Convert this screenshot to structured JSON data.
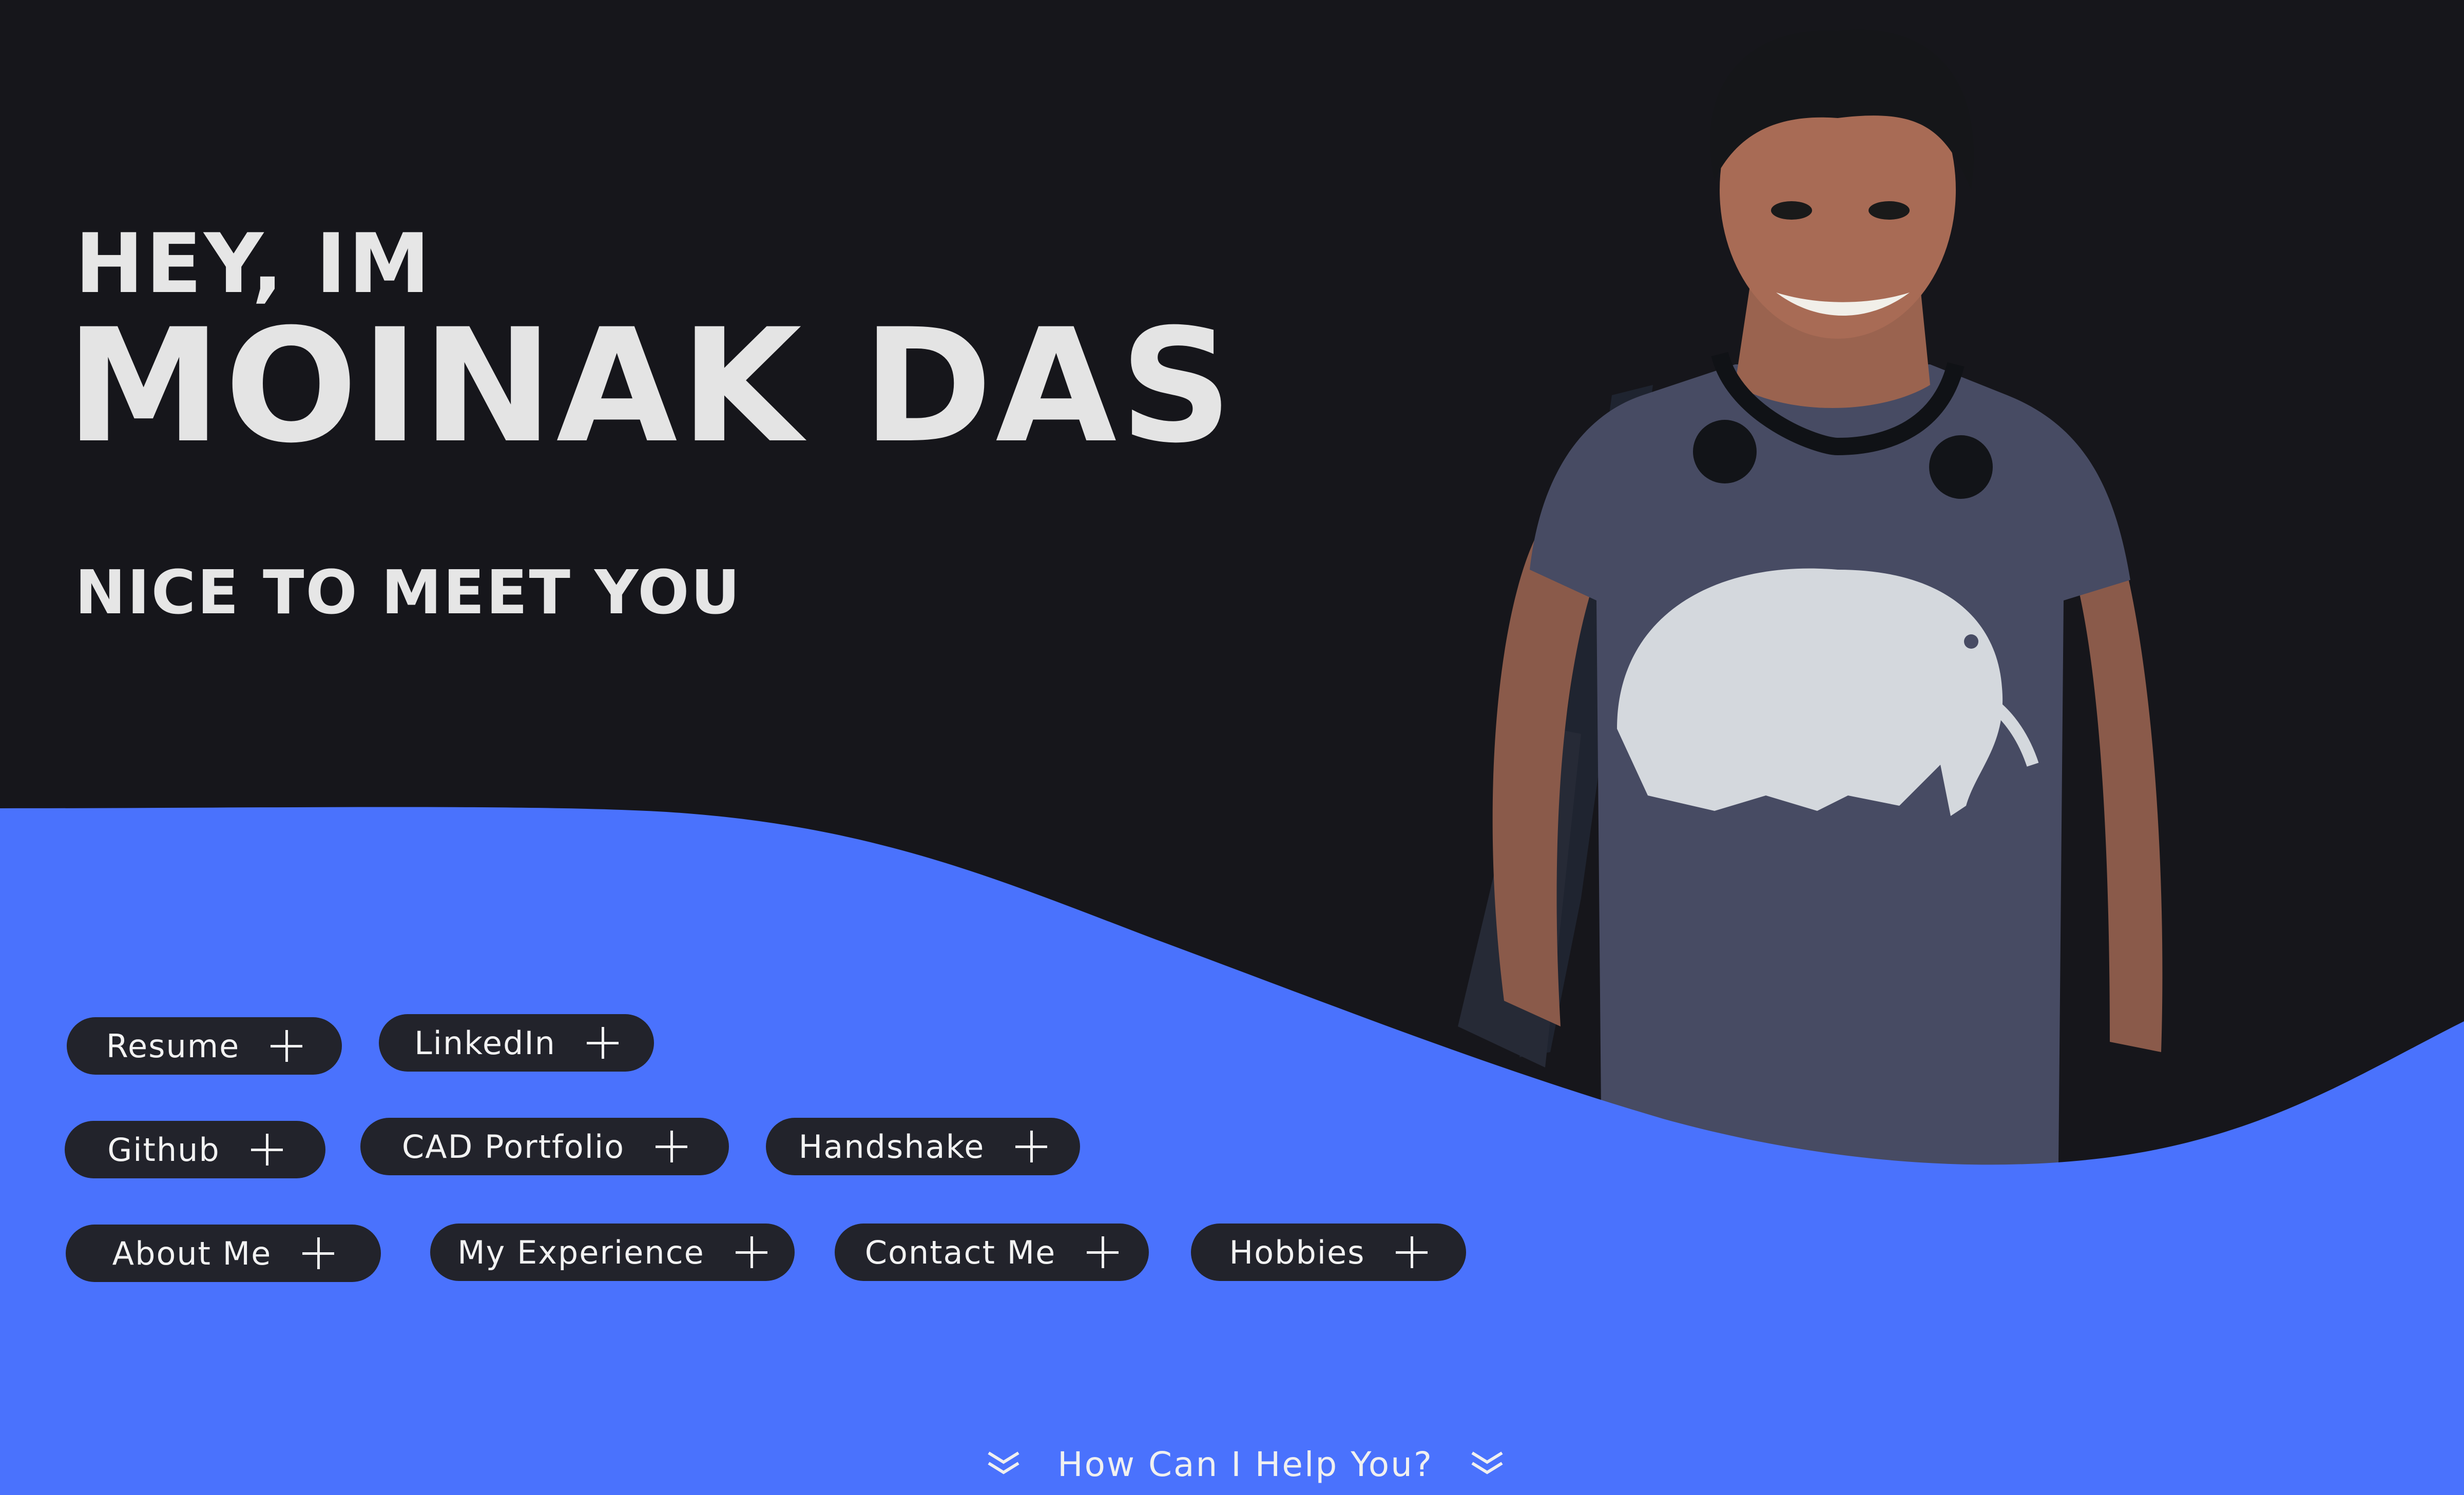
{
  "hero": {
    "greeting": "HEY, IM",
    "name": "MOINAK DAS",
    "tagline": "NICE TO MEET YOU"
  },
  "links": [
    {
      "label": "Resume",
      "icon": "plus-icon"
    },
    {
      "label": "LinkedIn",
      "icon": "plus-icon"
    },
    {
      "label": "Github",
      "icon": "plus-icon"
    },
    {
      "label": "CAD Portfolio",
      "icon": "plus-icon"
    },
    {
      "label": "Handshake",
      "icon": "plus-icon"
    },
    {
      "label": "About Me",
      "icon": "plus-icon"
    },
    {
      "label": "My Experience",
      "icon": "plus-icon"
    },
    {
      "label": "Contact Me",
      "icon": "plus-icon"
    },
    {
      "label": "Hobbies",
      "icon": "plus-icon"
    }
  ],
  "cta": {
    "label": "How Can I Help You?",
    "icon": "double-chevron-down-icon"
  },
  "colors": {
    "background": "#16161b",
    "accent": "#4a72fd",
    "button": "#22232b",
    "text": "#e6e6e6"
  }
}
